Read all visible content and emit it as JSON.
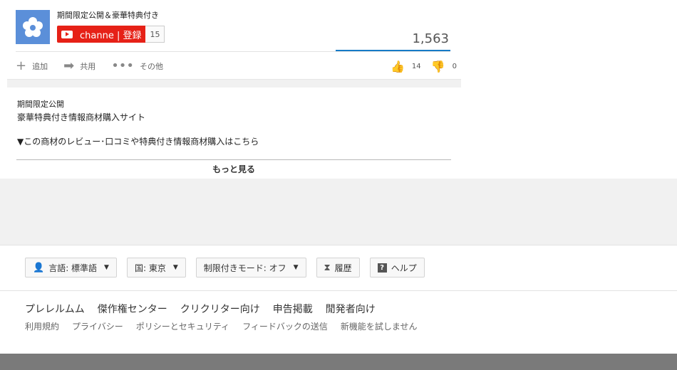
{
  "channel": {
    "name": "期間限定公開＆豪華特典付き",
    "subscribe_label": "channe | 登録",
    "subscriber_count": "15"
  },
  "stats": {
    "views": "1,563",
    "likes": "14",
    "dislikes": "0"
  },
  "actions": {
    "add": "追加",
    "share": "共用",
    "more": "その他"
  },
  "description": {
    "line1": "期間限定公開",
    "line2": "豪華特典付き情報商材購入サイト",
    "line3": "▼この商材のレビュー･口コミや特典付き情報商材購入はこちら",
    "show_more": "もっと見る"
  },
  "footer": {
    "language": "言語: 標準語",
    "country": "国: 東京",
    "restricted": "制限付きモード: オフ",
    "history": "履歴",
    "help": "ヘルプ",
    "primary_links": [
      "プレレルムム",
      "傑作権センター",
      "クリクリター向け",
      "申告掲載",
      "閒発者向け"
    ],
    "secondary_links": [
      "利用規約",
      "プライバシー",
      "ポリシーとセキュリティ",
      "フィードバックの送信",
      "新機能を試しません"
    ]
  },
  "colors": {
    "subscribe_red": "#e62117",
    "views_bar_blue": "#167ac6"
  }
}
